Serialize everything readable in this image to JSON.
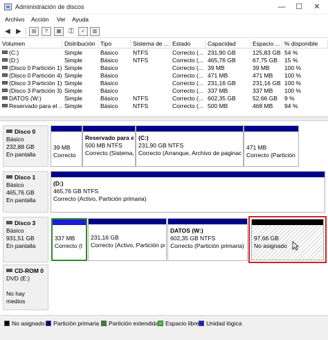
{
  "window": {
    "title": "Administración de discos",
    "min": "—",
    "max": "☐",
    "close": "✕"
  },
  "menu": [
    "Archivo",
    "Acción",
    "Ver",
    "Ayuda"
  ],
  "columns": [
    "Volumen",
    "Distribución",
    "Tipo",
    "Sistema de ...",
    "Estado",
    "Capacidad",
    "Espacio ...",
    "% disponible"
  ],
  "volumes": [
    [
      "(C:)",
      "Simple",
      "Básico",
      "NTFS",
      "Correcto (...",
      "231,90 GB",
      "125,83 GB",
      "54 %"
    ],
    [
      "(D:)",
      "Simple",
      "Básico",
      "NTFS",
      "Correcto (...",
      "465,76 GB",
      "67,75 GB",
      "15 %"
    ],
    [
      "(Disco 0 Partición 1)",
      "Simple",
      "Básico",
      "",
      "Correcto (...",
      "39 MB",
      "39 MB",
      "100 %"
    ],
    [
      "(Disco 0 Partición 4)",
      "Simple",
      "Básico",
      "",
      "Correcto (...",
      "471 MB",
      "471 MB",
      "100 %"
    ],
    [
      "(Disco 3 Partición 1)",
      "Simple",
      "Básico",
      "",
      "Correcto (...",
      "231,16 GB",
      "231,16 GB",
      "100 %"
    ],
    [
      "(Disco 3 Partición 3)",
      "Simple",
      "Básico",
      "",
      "Correcto (...",
      "337 MB",
      "337 MB",
      "100 %"
    ],
    [
      "DATOS (W:)",
      "Simple",
      "Básico",
      "NTFS",
      "Correcto (...",
      "602,35 GB",
      "52,66 GB",
      "9 %"
    ],
    [
      "Reservado para el ...",
      "Simple",
      "Básico",
      "NTFS",
      "Correcto (...",
      "500 MB",
      "468 MB",
      "94 %"
    ]
  ],
  "disks": [
    {
      "name": "Disco 0",
      "type": "Básico",
      "size": "232,88 GB",
      "state": "En pantalla",
      "partitions": [
        {
          "name": "",
          "size": "39 MB",
          "status": "Correcto"
        },
        {
          "name": "Reservado para el",
          "size": "500 MB NTFS",
          "status": "Correcto (Sistema,"
        },
        {
          "name": "(C:)",
          "size": "231,90 GB NTFS",
          "status": "Correcto (Arranque, Archivo de paginaci"
        },
        {
          "name": "",
          "size": "471 MB",
          "status": "Correcto (Partición"
        }
      ]
    },
    {
      "name": "Disco 1",
      "type": "Básico",
      "size": "465,76 GB",
      "state": "En pantalla",
      "partitions": [
        {
          "name": "(D:)",
          "size": "465,76 GB NTFS",
          "status": "Correcto (Activo, Partición primaria)"
        }
      ]
    },
    {
      "name": "Disco 3",
      "type": "Básico",
      "size": "931,51 GB",
      "state": "En pantalla",
      "partitions": [
        {
          "name": "",
          "size": "337 MB",
          "status": "Correcto (I"
        },
        {
          "name": "",
          "size": "231,16 GB",
          "status": "Correcto (Activo, Partición pr"
        },
        {
          "name": "DATOS  (W:)",
          "size": "602,35 GB NTFS",
          "status": "Correcto (Partición primaria)"
        },
        {
          "name": "",
          "size": "97,66 GB",
          "status": "No asignado"
        }
      ]
    },
    {
      "name": "CD-ROM 0",
      "type": "DVD (E:)",
      "size": "",
      "state": "No hay medios"
    }
  ],
  "legend": [
    {
      "label": "No asignado",
      "color": "#000000"
    },
    {
      "label": "Partición primaria",
      "color": "#00008b"
    },
    {
      "label": "Partición extendida",
      "color": "#2e8b2e"
    },
    {
      "label": "Espacio libre",
      "color": "#35d435"
    },
    {
      "label": "Unidad lógica",
      "color": "#1c1cd6"
    }
  ],
  "colors": {
    "primary": "#00008b",
    "unallocated": "#000000",
    "highlight": "#d41f1f"
  }
}
